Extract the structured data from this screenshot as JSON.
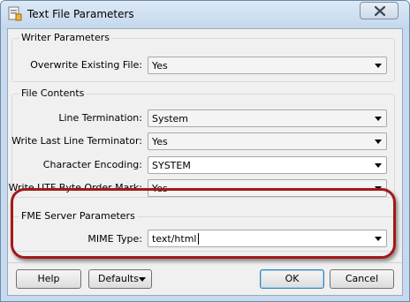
{
  "window": {
    "title": "Text File Parameters"
  },
  "writer_params": {
    "label": "Writer Parameters",
    "overwrite_label": "Overwrite Existing File:",
    "overwrite_value": "Yes"
  },
  "file_contents": {
    "label": "File Contents",
    "line_termination_label": "Line Termination:",
    "line_termination_value": "System",
    "write_last_label": "Write Last Line Terminator:",
    "write_last_value": "Yes",
    "encoding_label": "Character Encoding:",
    "encoding_value": "SYSTEM",
    "bom_label": "Write UTF Byte Order Mark:",
    "bom_value": "Yes"
  },
  "server_params": {
    "label": "FME Server Parameters",
    "mime_label": "MIME Type:",
    "mime_value": "text/html"
  },
  "buttons": {
    "help": "Help",
    "defaults": "Defaults",
    "ok": "OK",
    "cancel": "Cancel"
  },
  "colors": {
    "highlight_ring": "#a31919",
    "titlebar": "#c6d9ee"
  },
  "icons": {
    "app": "fme-app-icon",
    "close": "close-icon",
    "dropdown": "chevron-down-icon"
  }
}
